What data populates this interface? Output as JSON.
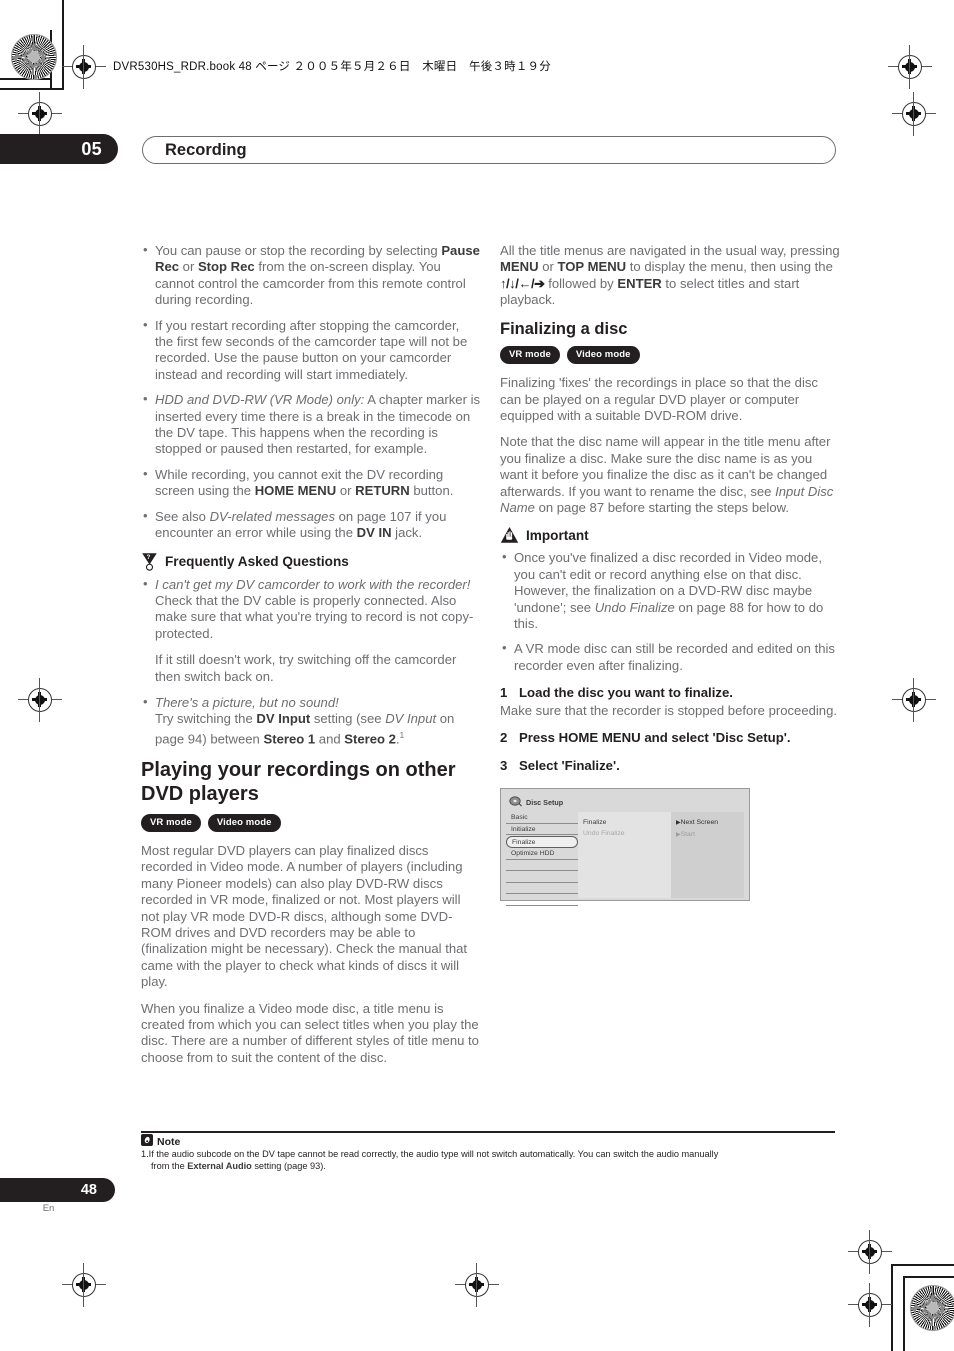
{
  "slug": {
    "text": "DVR530HS_RDR.book  48 ページ  ２００５年５月２６日　木曜日　午後３時１９分"
  },
  "header": {
    "chapter_number": "05",
    "chapter_title": "Recording"
  },
  "left_column": {
    "bullets_1": [
      "You can pause or stop the recording by selecting <b>Pause Rec</b> or <b>Stop Rec</b> from the on-screen display. You cannot control the camcorder from this remote control during recording.",
      "If you restart recording after stopping the camcorder, the first few seconds of the camcorder tape will not be recorded. Use the pause button on your camcorder instead and recording will start immediately.",
      "<i>HDD and DVD-RW (VR Mode) only:</i> A chapter marker is inserted every time there is a break in the timecode on the DV tape. This happens when the recording is stopped or paused then restarted, for example.",
      "While recording, you cannot exit the DV recording screen using the <b>HOME MENU</b> or <b>RETURN</b> button.",
      "See also <i>DV-related messages</i> on page 107 if you encounter an error while using the <b>DV IN</b> jack."
    ],
    "faq": {
      "icon": "question-bulb-icon",
      "title": "Frequently Asked Questions",
      "items": [
        {
          "question": "I can't get my DV camcorder to work with the recorder!",
          "answers": [
            "Check that the DV cable is properly connected. Also make sure that what you're trying to record is not copy-protected.",
            "If it still doesn't work, try switching off the camcorder then switch back on."
          ]
        },
        {
          "question": "There's a picture, but no sound!",
          "answers": [
            "Try switching the <b>DV Input</b> setting (see <i>DV Input</i> on page 94) between <b>Stereo 1</b> and <b>Stereo 2</b>.<sup>1</sup>"
          ]
        }
      ]
    },
    "section": {
      "heading": "Playing your recordings on other DVD players",
      "badges": [
        "VR mode",
        "Video mode"
      ],
      "paragraphs": [
        "Most regular DVD players can play finalized discs recorded in Video mode. A number of players (including many Pioneer models) can also play DVD-RW discs recorded in VR mode, finalized or not. Most players will not play VR mode DVD-R discs, although some DVD-ROM drives and DVD recorders may be able to (finalization might be necessary). Check the manual that came with the player to check what kinds of discs it will play.",
        "When you finalize a Video mode disc, a title menu is created from which you can select titles when you play the disc. There are a number of different styles of title menu to choose from to suit the content of the disc."
      ]
    }
  },
  "right_column": {
    "intro": "All the title menus are navigated in the usual way, pressing <b>MENU</b> or <b>TOP MENU</b> to display the menu, then using the <span class=\"arrowglyphs\">↑/↓/←/➔</span> followed by <b>ENTER</b> to select titles and start playback.",
    "section": {
      "heading": "Finalizing a disc",
      "badges": [
        "VR mode",
        "Video mode"
      ],
      "paragraphs": [
        "Finalizing 'fixes' the recordings in place so that the disc can be played on a regular DVD player or computer equipped with a suitable DVD-ROM drive.",
        "Note that the disc name will appear in the title menu after you finalize a disc. Make sure the disc name is as you want it before you finalize the disc as it can't be changed afterwards. If you want to rename the disc, see <i>Input Disc Name</i> on page 87 before starting the steps below."
      ]
    },
    "important": {
      "icon": "warning-hand-icon",
      "title": "Important",
      "bullets": [
        "Once you've finalized a disc recorded in Video mode, you can't edit or record anything else on that disc. However, the finalization on a DVD-RW disc maybe 'undone'; see <i>Undo Finalize</i> on page 88 for how to do this.",
        "A VR mode disc can still be recorded and edited on this recorder even after finalizing."
      ]
    },
    "steps": [
      {
        "num": "1",
        "title": "Load the disc you want to finalize.",
        "body": "Make sure that the recorder is stopped before proceeding."
      },
      {
        "num": "2",
        "title": "Press HOME MENU and select 'Disc Setup'.",
        "body": ""
      },
      {
        "num": "3",
        "title": "Select 'Finalize'.",
        "body": ""
      }
    ],
    "figure": {
      "title": "Disc Setup",
      "icon": "disc-icon",
      "menu_items": [
        "Basic",
        "Initialize",
        "Finalize",
        "Optimize HDD"
      ],
      "selected_menu_item": "Finalize",
      "options": [
        {
          "label": "Finalize",
          "dimmed": false
        },
        {
          "label": "Undo Finalize",
          "dimmed": true
        }
      ],
      "actions": [
        {
          "label": "Next Screen",
          "dimmed": false
        },
        {
          "label": "Start",
          "dimmed": true
        }
      ]
    }
  },
  "footnote": {
    "icon": "note-icon",
    "title": "Note",
    "index": "1.",
    "text_line1": "If the audio subcode on the DV tape cannot be read correctly, the audio type will not switch automatically. You can switch the audio manually",
    "text_line2": "from the <b>External Audio</b> setting (page 93)."
  },
  "footer": {
    "page_number": "48",
    "language": "En"
  },
  "colors": {
    "ink_black": "#231f20",
    "body_gray": "#6d6e71",
    "figure_bg": "#d9d9d9"
  }
}
